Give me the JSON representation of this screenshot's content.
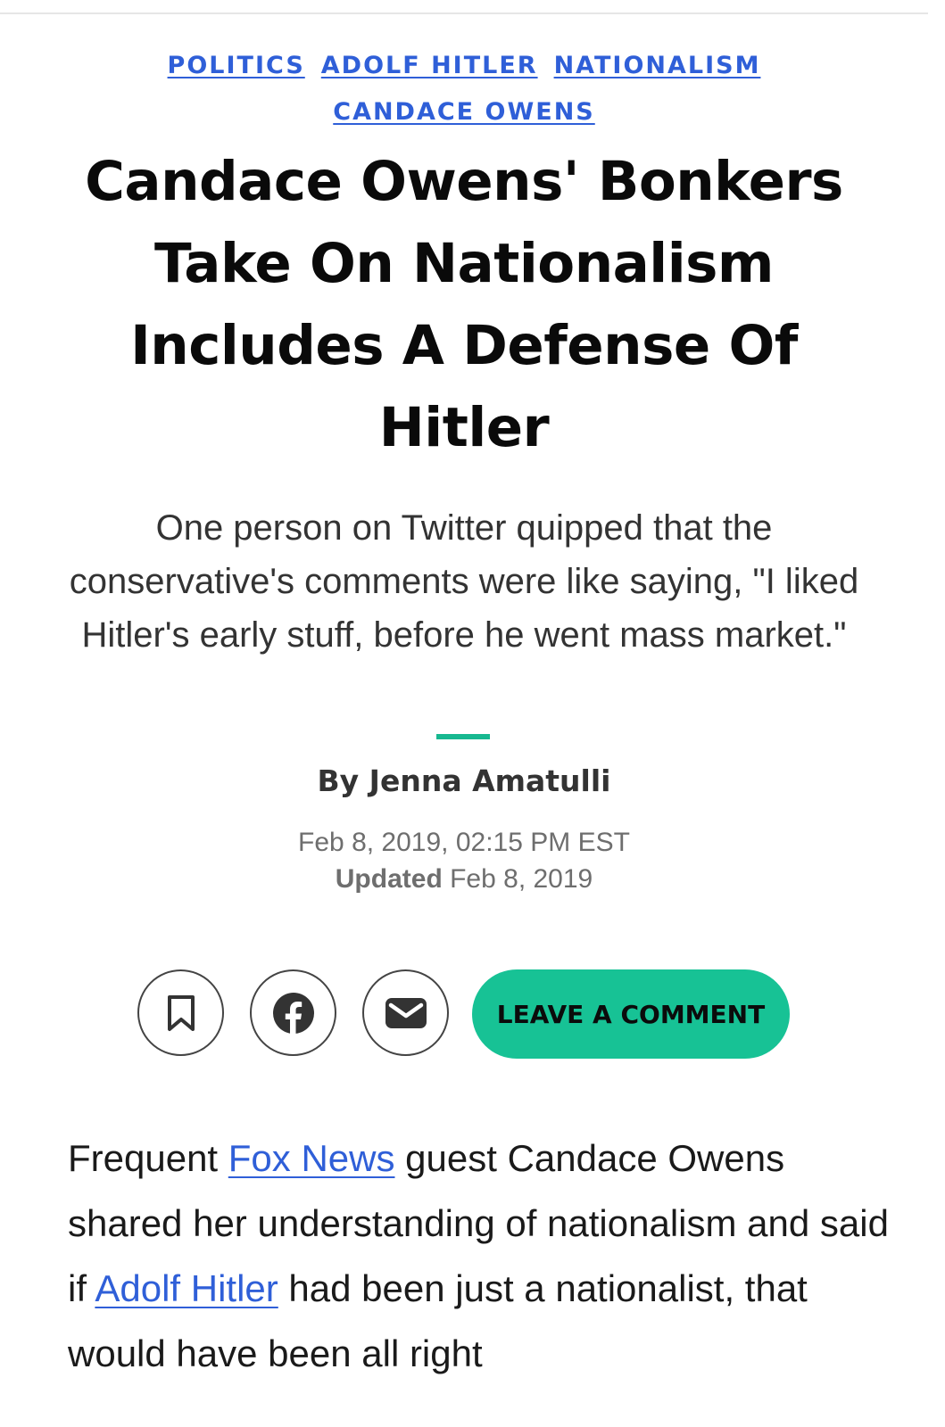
{
  "tags": [
    "POLITICS",
    "ADOLF HITLER",
    "NATIONALISM",
    "CANDACE OWENS"
  ],
  "headline": "Candace Owens' Bonkers Take On Nationalism Includes A Defense Of Hitler",
  "dek": "One person on Twitter quipped that the conservative's comments were like saying, \"I liked Hitler's early stuff, before he went mass market.\"",
  "byline": "By Jenna Amatulli",
  "dates": {
    "published": "Feb 8, 2019, 02:15 PM EST",
    "updated_label": "Updated",
    "updated": "Feb 8, 2019"
  },
  "share": {
    "bookmark_icon": "bookmark-icon",
    "facebook_icon": "facebook-icon",
    "email_icon": "email-icon",
    "comment_label": "LEAVE A COMMENT"
  },
  "article": {
    "p1_a": "Frequent ",
    "link_fox": "Fox News",
    "p1_b": " guest Candace Owens shared her understanding of nationalism and said if ",
    "link_hitler": "Adolf Hitler",
    "p1_c": " had been just a nationalist, that would have been all right"
  },
  "colors": {
    "link": "#2f5fd8",
    "accent": "#17c295"
  }
}
